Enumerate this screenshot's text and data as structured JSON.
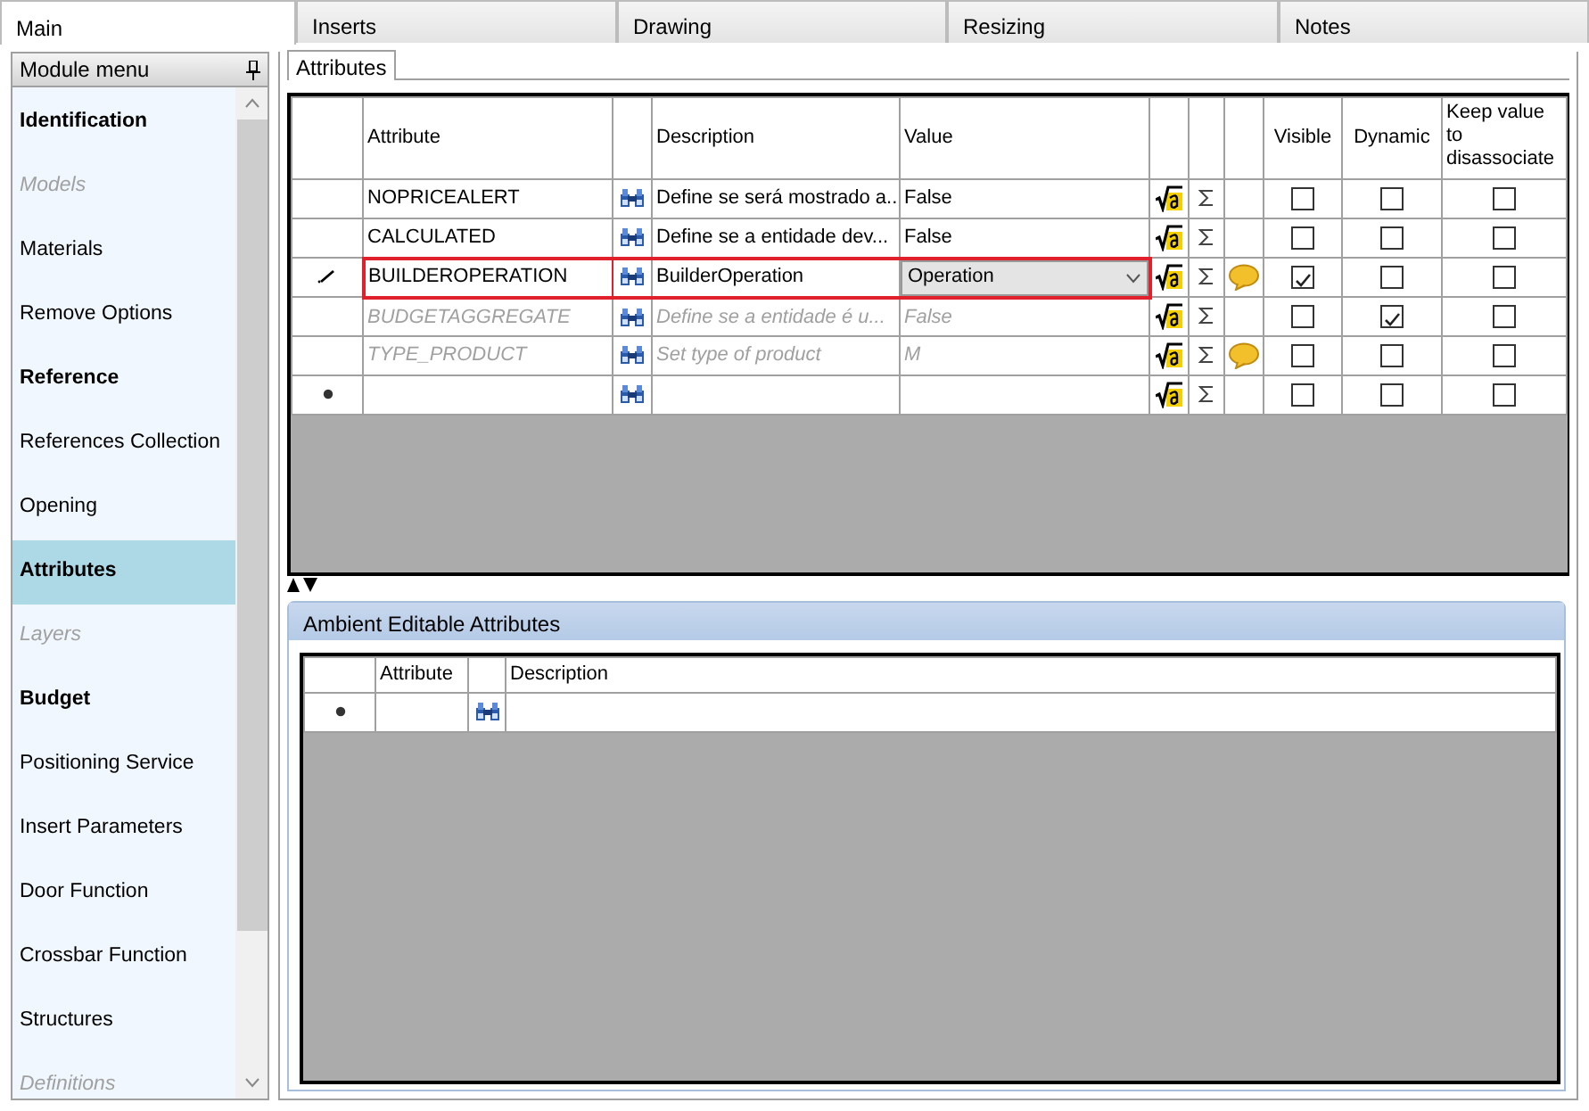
{
  "tabs": [
    {
      "label": "Main",
      "selected": true
    },
    {
      "label": "Inserts",
      "selected": false
    },
    {
      "label": "Drawing",
      "selected": false
    },
    {
      "label": "Resizing",
      "selected": false
    },
    {
      "label": "Notes",
      "selected": false
    }
  ],
  "module_menu": {
    "title": "Module menu",
    "items": [
      {
        "label": "Identification",
        "kind": "bold",
        "selected": false
      },
      {
        "label": "Models",
        "kind": "disabled",
        "selected": false
      },
      {
        "label": "Materials",
        "kind": "normal",
        "selected": false
      },
      {
        "label": "Remove Options",
        "kind": "normal",
        "selected": false
      },
      {
        "label": "Reference",
        "kind": "bold",
        "selected": false
      },
      {
        "label": "References Collection",
        "kind": "normal",
        "selected": false
      },
      {
        "label": "Opening",
        "kind": "normal",
        "selected": false
      },
      {
        "label": "Attributes",
        "kind": "bold",
        "selected": true
      },
      {
        "label": "Layers",
        "kind": "disabled",
        "selected": false
      },
      {
        "label": "Budget",
        "kind": "bold",
        "selected": false
      },
      {
        "label": "Positioning Service",
        "kind": "normal",
        "selected": false
      },
      {
        "label": "Insert Parameters",
        "kind": "normal",
        "selected": false
      },
      {
        "label": "Door Function",
        "kind": "normal",
        "selected": false
      },
      {
        "label": "Crossbar Function",
        "kind": "normal",
        "selected": false
      },
      {
        "label": "Structures",
        "kind": "normal",
        "selected": false
      },
      {
        "label": "Definitions",
        "kind": "disabled",
        "selected": false
      }
    ]
  },
  "sub_tabs": [
    {
      "label": "Attributes",
      "selected": true
    }
  ],
  "attributes_table": {
    "columns": [
      "Attribute",
      "Description",
      "Value",
      "Visible",
      "Dynamic",
      "Keep value to disassociate"
    ],
    "rows": [
      {
        "kind": "data",
        "attribute": "NOPRICEALERT",
        "description": "Define se será mostrado a...",
        "value": "False",
        "disabled": false,
        "selected": false,
        "comment": false,
        "visible": false,
        "dynamic": false,
        "keep": false
      },
      {
        "kind": "data",
        "attribute": "CALCULATED",
        "description": "Define se a entidade dev...",
        "value": "False",
        "disabled": false,
        "selected": false,
        "comment": false,
        "visible": false,
        "dynamic": false,
        "keep": false
      },
      {
        "kind": "editing",
        "attribute": "BUILDEROPERATION",
        "description": "BuilderOperation",
        "value": "Operation",
        "disabled": false,
        "selected": true,
        "comment": true,
        "visible": true,
        "dynamic": false,
        "keep": false
      },
      {
        "kind": "data",
        "attribute": "BUDGETAGGREGATE",
        "description": "Define se a entidade é u...",
        "value": "False",
        "disabled": true,
        "selected": false,
        "comment": false,
        "visible": false,
        "dynamic": true,
        "keep": false
      },
      {
        "kind": "data",
        "attribute": "TYPE_PRODUCT",
        "description": "Set type of product",
        "value": "M",
        "disabled": true,
        "selected": false,
        "comment": true,
        "visible": false,
        "dynamic": false,
        "keep": false
      },
      {
        "kind": "new",
        "visible": false,
        "dynamic": false,
        "keep": false
      }
    ]
  },
  "ambient_editable_attributes": {
    "title": "Ambient Editable Attributes",
    "columns": [
      "Attribute",
      "Description"
    ],
    "rows": [
      {
        "kind": "new"
      }
    ]
  }
}
